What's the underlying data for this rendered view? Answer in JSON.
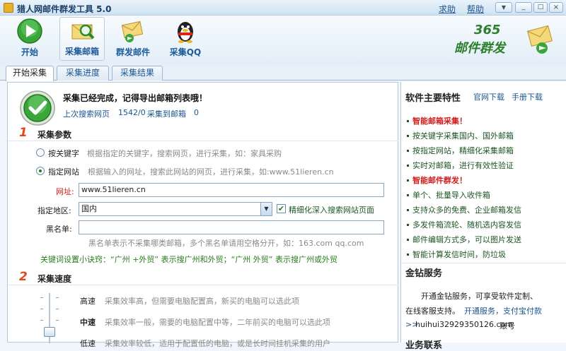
{
  "window": {
    "title": "猎人网邮件群发工具 5.0",
    "help_link": "求助",
    "help2_link": "帮助"
  },
  "toolbar": {
    "buttons": [
      {
        "label": "开始",
        "icon": "play-icon"
      },
      {
        "label": "采集邮箱",
        "icon": "search-mail-icon",
        "selected": true
      },
      {
        "label": "群发邮件",
        "icon": "mail-send-icon"
      },
      {
        "label": "采集QQ",
        "icon": "qq-penguin-icon"
      }
    ],
    "logo": {
      "top": "365",
      "bottom": "邮件群发"
    }
  },
  "tabs": [
    "开始采集",
    "采集进度",
    "采集结果"
  ],
  "status": {
    "message": "采集已经完成，记得导出邮箱列表哦！",
    "last_label": "上次搜索网页",
    "last_value": "1542/0",
    "found_label": "采集到邮箱",
    "found_value": "0"
  },
  "params": {
    "number": "1",
    "title": "采集参数",
    "keyword_option": {
      "label": "按关键字",
      "desc": "根据指定的关键字，搜索网页，进行采集，如：家具采购",
      "selected": false
    },
    "site_option": {
      "label": "指定网站",
      "desc": "根据输入的网址，搜索此网站的网页，进行采集，如:www.51lieren.cn",
      "selected": true
    },
    "url_label": "网址:",
    "url_value": "www.51lieren.cn",
    "region_label": "指定地区:",
    "region_value": "国内",
    "deep_label": "精细化深入搜索网站页面",
    "deep_checked": true,
    "blacklist_label": "黑名单:",
    "blacklist_value": "",
    "blacklist_hint": "黑名单表示不采集哪类邮箱，多个黑名单请用空格分开，如：163.com qq.com",
    "tip": "关键词设置小诀窍：“广州 +外贸” 表示搜广州和外贸；“广州 外贸” 表示搜广州或外贸"
  },
  "speed": {
    "number": "2",
    "title": "采集速度",
    "levels": [
      {
        "label": "高速",
        "desc": "采集效率高，但需要电脑配置高，新买的电脑可以选此项"
      },
      {
        "label": "中速",
        "desc": "采集效率一般，需要的电脑配置中等，二年前买的电脑可以选此项"
      },
      {
        "label": "低速",
        "desc": "采集效率较低，适用于配置低的电脑，或是长时间挂机采集的用户"
      }
    ],
    "selected_level": "中速"
  },
  "sidebar": {
    "features_title": "软件主要特性",
    "official_link": "官网下载",
    "manual_link": "手册下载",
    "features": [
      {
        "text": "智能邮箱采集！",
        "highlight": true
      },
      {
        "text": "按关键字采集国内、国外邮箱",
        "highlight": false
      },
      {
        "text": "按指定网站，精细化采集邮箱",
        "highlight": false
      },
      {
        "text": "实时对邮箱，进行有效性验证",
        "highlight": false
      },
      {
        "text": "智能邮件群发！",
        "highlight": true
      },
      {
        "text": "单个、批量导入收件箱",
        "highlight": false
      },
      {
        "text": "支持众多的免费、企业邮箱发信",
        "highlight": false
      },
      {
        "text": "多发件箱流轮、随机选内容发信",
        "highlight": false
      },
      {
        "text": "邮件编辑方式多，可以图片发送",
        "highlight": false
      },
      {
        "text": "智能计算发信时间，防垃圾",
        "highlight": false
      }
    ],
    "gold_title": "金钻服务",
    "gold_line1": "开通金钻服务，可享受软件定制、",
    "gold_line2_a": "在线客服支持。",
    "gold_line2_b": "开通服务，支付宝付款",
    "gold_line3_a": ">>",
    "gold_line3_b": "huihui32929350126.com",
    "gold_line3_c": "账号",
    "business_title": "业务联系"
  },
  "colors": {
    "accent": "#1c5590",
    "red": "#d21c1c",
    "green": "#1d5525",
    "orange": "#e2461c"
  }
}
